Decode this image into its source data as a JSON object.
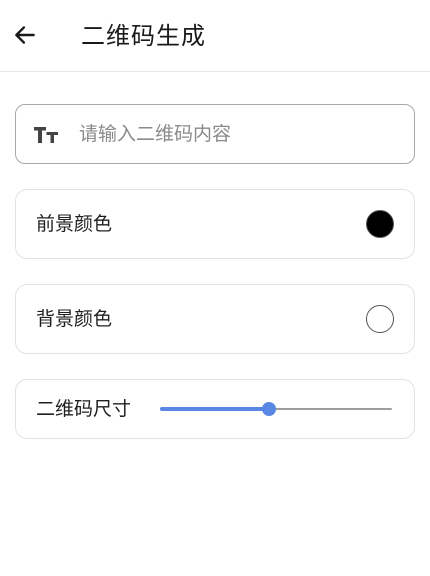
{
  "header": {
    "back_icon": "arrow-left-icon",
    "title": "二维码生成"
  },
  "content_input": {
    "icon": "text-size-icon",
    "value": "",
    "placeholder": "请输入二维码内容"
  },
  "foreground": {
    "label": "前景颜色",
    "color": "#000000"
  },
  "background": {
    "label": "背景颜色",
    "color": "#ffffff"
  },
  "size": {
    "label": "二维码尺寸",
    "value_fraction": 0.47
  },
  "colors": {
    "accent": "#5887e4",
    "slider_track": "#9e9e9e",
    "card_border": "#e2e2e2",
    "input_border": "#a8a8a8"
  }
}
